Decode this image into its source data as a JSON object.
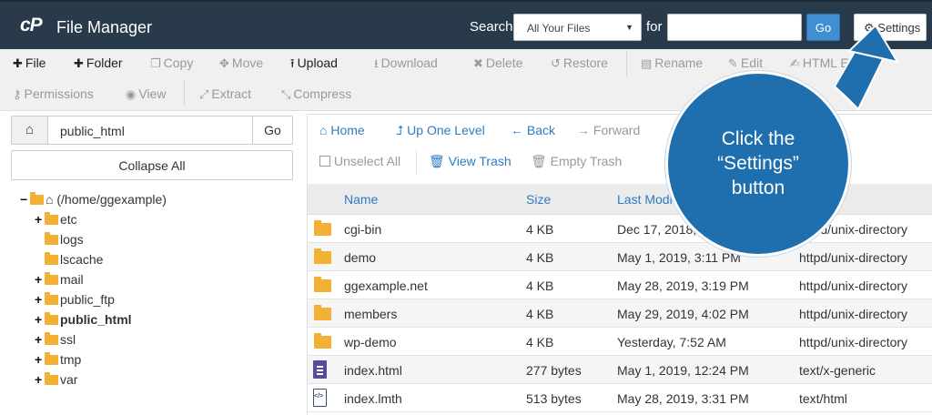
{
  "header": {
    "logo": "cP",
    "title": "File Manager",
    "search_label": "Search",
    "search_scope": "All Your Files",
    "for_label": "for",
    "search_value": "",
    "go_label": "Go",
    "settings_label": "Settings"
  },
  "toolbar": {
    "row1": [
      {
        "icon": "plus-icon",
        "label": "File",
        "active": true
      },
      {
        "icon": "plus-icon",
        "label": "Folder",
        "active": true
      },
      {
        "icon": "copy-icon",
        "label": "Copy",
        "active": false
      },
      {
        "icon": "move-icon",
        "label": "Move",
        "active": false
      },
      {
        "icon": "upload-icon",
        "label": "Upload",
        "active": true
      },
      {
        "icon": "download-icon",
        "label": "Download",
        "active": false
      },
      {
        "icon": "delete-icon",
        "label": "Delete",
        "active": false
      },
      {
        "icon": "restore-icon",
        "label": "Restore",
        "active": false
      },
      {
        "icon": "rename-icon",
        "label": "Rename",
        "active": false
      },
      {
        "icon": "edit-icon",
        "label": "Edit",
        "active": false
      },
      {
        "icon": "html-editor-icon",
        "label": "HTML Editor",
        "active": false
      }
    ],
    "row2": [
      {
        "icon": "permissions-icon",
        "label": "Permissions",
        "active": false
      },
      {
        "icon": "view-icon",
        "label": "View",
        "active": false
      },
      {
        "icon": "extract-icon",
        "label": "Extract",
        "active": false
      },
      {
        "icon": "compress-icon",
        "label": "Compress",
        "active": false
      }
    ]
  },
  "sidebar": {
    "path_value": "public_html",
    "go_label": "Go",
    "collapse_label": "Collapse All",
    "tree": [
      {
        "label": "(/home/ggexample)",
        "toggle": "−",
        "root": true
      },
      {
        "label": "etc",
        "toggle": "+"
      },
      {
        "label": "logs",
        "toggle": ""
      },
      {
        "label": "lscache",
        "toggle": ""
      },
      {
        "label": "mail",
        "toggle": "+"
      },
      {
        "label": "public_ftp",
        "toggle": "+"
      },
      {
        "label": "public_html",
        "toggle": "+",
        "bold": true
      },
      {
        "label": "ssl",
        "toggle": "+"
      },
      {
        "label": "tmp",
        "toggle": "+"
      },
      {
        "label": "var",
        "toggle": "+"
      }
    ]
  },
  "nav": {
    "home": "Home",
    "up_one_level": "Up One Level",
    "back": "Back",
    "forward": "Forward",
    "unselect_all": "Unselect All",
    "view_trash": "View Trash",
    "empty_trash": "Empty Trash"
  },
  "table": {
    "headers": {
      "name": "Name",
      "size": "Size",
      "last_modified": "Last Modi"
    },
    "rows": [
      {
        "type": "folder",
        "name": "cgi-bin",
        "size": "4 KB",
        "modified": "Dec 17, 2018,",
        "mime": "httpd/unix-directory"
      },
      {
        "type": "folder",
        "name": "demo",
        "size": "4 KB",
        "modified": "May 1, 2019, 3:11 PM",
        "mime": "httpd/unix-directory"
      },
      {
        "type": "folder",
        "name": "ggexample.net",
        "size": "4 KB",
        "modified": "May 28, 2019, 3:19 PM",
        "mime": "httpd/unix-directory"
      },
      {
        "type": "folder",
        "name": "members",
        "size": "4 KB",
        "modified": "May 29, 2019, 4:02 PM",
        "mime": "httpd/unix-directory"
      },
      {
        "type": "folder",
        "name": "wp-demo",
        "size": "4 KB",
        "modified": "Yesterday, 7:52 AM",
        "mime": "httpd/unix-directory"
      },
      {
        "type": "generic",
        "name": "index.html",
        "size": "277 bytes",
        "modified": "May 1, 2019, 12:24 PM",
        "mime": "text/x-generic"
      },
      {
        "type": "code",
        "name": "index.lmth",
        "size": "513 bytes",
        "modified": "May 28, 2019, 3:31 PM",
        "mime": "text/html"
      }
    ]
  },
  "callout": {
    "line1": "Click the",
    "line2": "“Settings”",
    "line3": "button"
  },
  "colors": {
    "header_bg": "#293a4a",
    "accent_blue": "#2f7ac2",
    "go_button": "#3f8fd2",
    "callout_blue": "#1f6fae",
    "folder_yellow": "#f2b134"
  }
}
